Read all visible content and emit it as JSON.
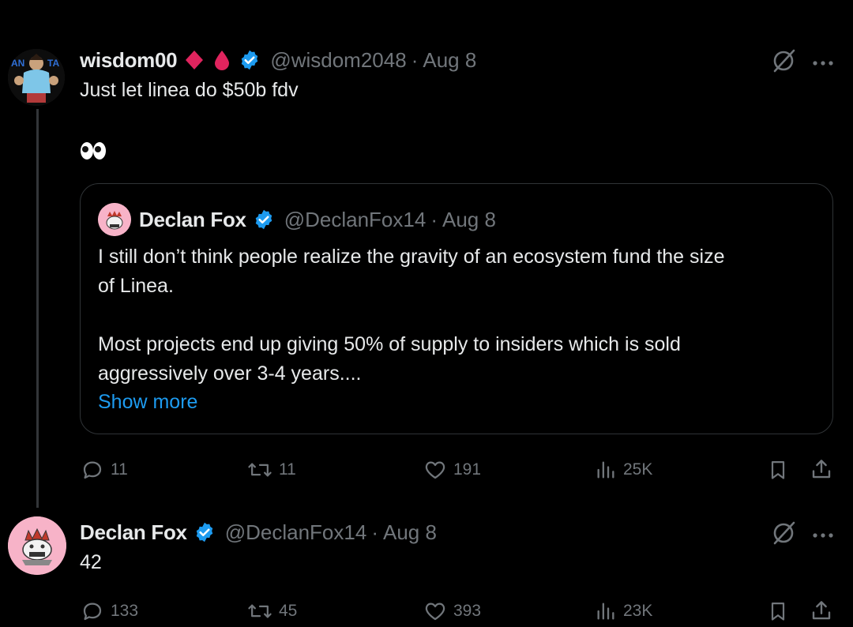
{
  "tweet1": {
    "author_name": "wisdom00",
    "handle": "@wisdom2048",
    "date": "Aug 8",
    "text_line1": "Just let linea do $50b fdv",
    "text_line2": "👀",
    "icons": {
      "badge1": "red-diamond-icon",
      "badge2": "red-drop-icon",
      "verified": "verified-badge-icon"
    },
    "quote": {
      "author_name": "Declan Fox",
      "handle": "@DeclanFox14",
      "date": "Aug 8",
      "line1": "I still don’t think people realize the gravity of an ecosystem fund the size",
      "line2": "of Linea.",
      "line3": "Most projects end up giving 50% of supply to insiders which is sold",
      "line4": "aggressively over 3-4 years....",
      "show_more": "Show more"
    },
    "stats": {
      "replies": "11",
      "reposts": "11",
      "likes": "191",
      "views": "25K"
    }
  },
  "tweet2": {
    "author_name": "Declan Fox",
    "handle": "@DeclanFox14",
    "date": "Aug 8",
    "text": "42",
    "stats": {
      "replies": "133",
      "reposts": "45",
      "likes": "393",
      "views": "23K"
    }
  },
  "separator": "·",
  "colors": {
    "background": "#000000",
    "text": "#e7e9ea",
    "muted": "#71767b",
    "link": "#1d9bf0",
    "verified": "#1d9bf0",
    "badge_red": "#e0245e",
    "avatar_pink": "#f7b3c8"
  }
}
